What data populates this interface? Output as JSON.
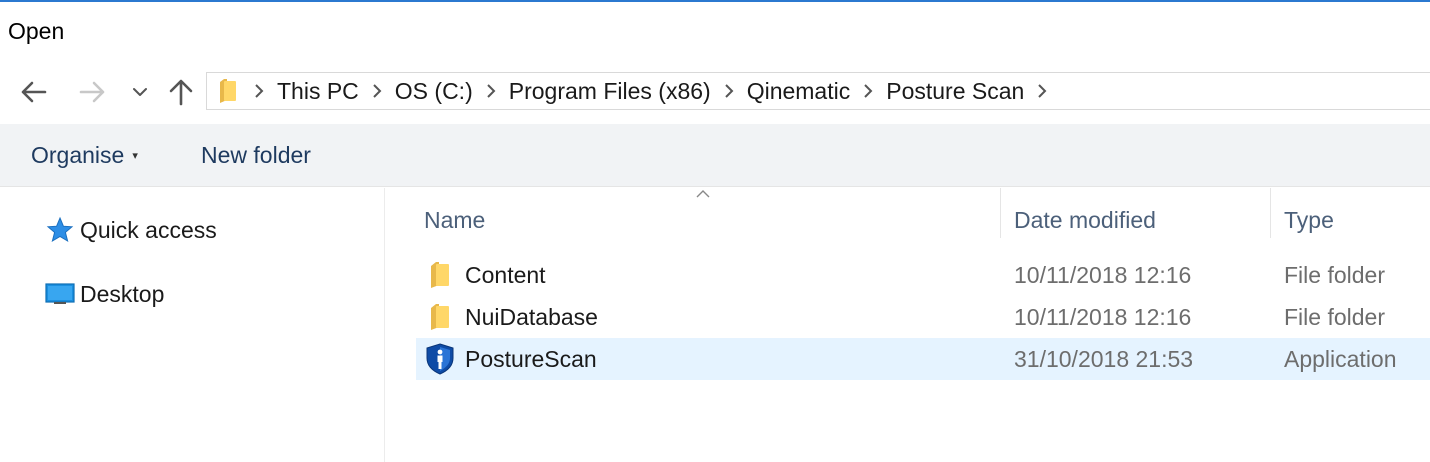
{
  "window": {
    "title": "Open",
    "accent_color": "#2b79d0"
  },
  "nav": {
    "back_icon": "arrow-left-icon",
    "forward_icon": "arrow-right-icon",
    "recent_icon": "chevron-down-icon",
    "up_icon": "arrow-up-icon"
  },
  "address": {
    "folder_icon": "folder-icon",
    "crumbs": [
      "This PC",
      "OS (C:)",
      "Program Files (x86)",
      "Qinematic",
      "Posture Scan"
    ]
  },
  "toolbar": {
    "organise_label": "Organise",
    "new_folder_label": "New folder"
  },
  "sidebar": {
    "items": [
      {
        "label": "Quick access",
        "icon": "star-icon"
      },
      {
        "label": "Desktop",
        "icon": "desktop-icon"
      }
    ]
  },
  "columns": {
    "name": "Name",
    "date": "Date modified",
    "type": "Type"
  },
  "files": [
    {
      "name": "Content",
      "date": "10/11/2018 12:16",
      "type": "File folder",
      "icon": "folder-icon",
      "selected": false
    },
    {
      "name": "NuiDatabase",
      "date": "10/11/2018 12:16",
      "type": "File folder",
      "icon": "folder-icon",
      "selected": false
    },
    {
      "name": "PostureScan",
      "date": "31/10/2018 21:53",
      "type": "Application",
      "icon": "posturescan-app-icon",
      "selected": true
    }
  ]
}
